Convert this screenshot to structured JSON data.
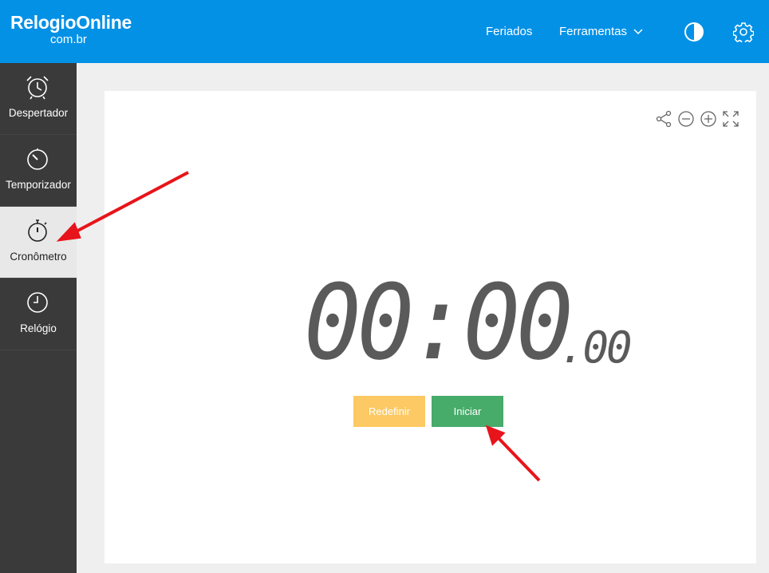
{
  "header": {
    "logo_main": "RelogioOnline",
    "logo_sub": "com.br",
    "nav": [
      {
        "label": "Feriados"
      },
      {
        "label": "Ferramentas"
      }
    ],
    "icons": [
      "contrast-icon",
      "gear-icon"
    ],
    "bg_color": "#0391e6"
  },
  "sidebar": {
    "items": [
      {
        "label": "Despertador",
        "icon": "alarm-clock-icon"
      },
      {
        "label": "Temporizador",
        "icon": "timer-icon"
      },
      {
        "label": "Cronômetro",
        "icon": "stopwatch-icon",
        "active": true
      },
      {
        "label": "Relógio",
        "icon": "clock-icon"
      }
    ]
  },
  "stopwatch": {
    "time": "00:00",
    "hundredths": ".00",
    "toolbar_icons": [
      "share-icon",
      "zoom-out-icon",
      "zoom-in-icon",
      "fullscreen-icon"
    ],
    "buttons": {
      "reset_label": "Redefinir",
      "start_label": "Iniciar"
    },
    "colors": {
      "reset": "#fcc964",
      "start": "#47ab6a",
      "digits": "#5a5a5a"
    }
  },
  "annotations": {
    "arrow_color": "#e8141b"
  }
}
